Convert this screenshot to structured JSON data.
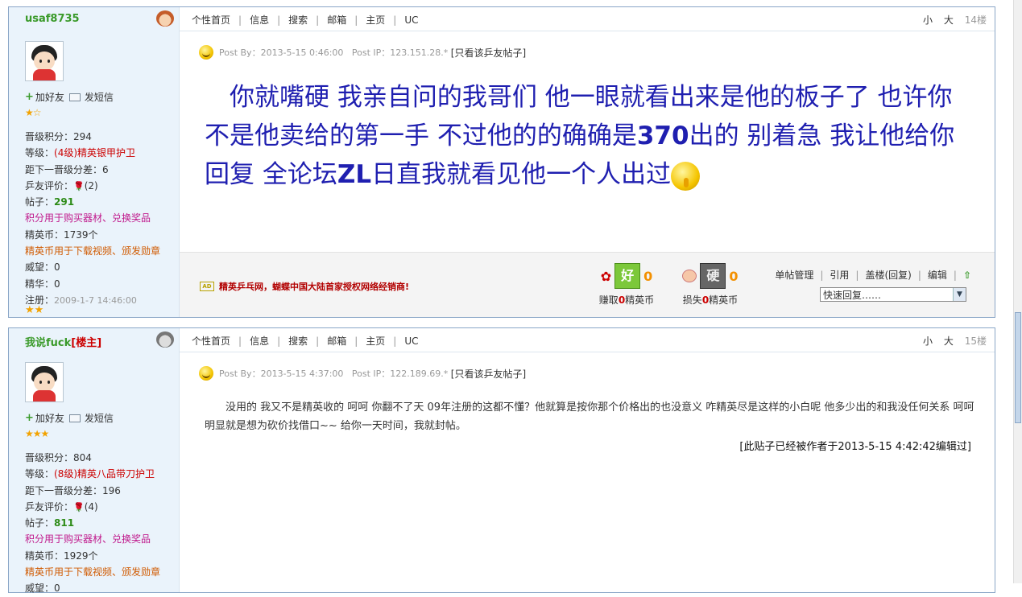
{
  "nav": [
    "个性首页",
    "信息",
    "搜索",
    "邮箱",
    "主页",
    "UC"
  ],
  "font_small": "小",
  "font_large": "大",
  "posts": [
    {
      "user": "usaf8735",
      "tag": "",
      "add_friend": "加好友",
      "send_msg": "发短信",
      "stars": "★☆",
      "info": [
        {
          "label": "晋级积分：",
          "value": "294"
        },
        {
          "label": "等级：",
          "value": "(4级)精英银甲护卫"
        },
        {
          "label": "距下一晋级分差：",
          "value": "6"
        },
        {
          "label": "乒友评价：",
          "value": "(2)"
        },
        {
          "label": "帖子：",
          "value": "291"
        },
        {
          "label": "",
          "value": "积分用于购买器材、兑换奖品"
        },
        {
          "label": "精英币：",
          "value": "1739个"
        },
        {
          "label": "",
          "value": "精英币用于下载视频、颁发勋章"
        },
        {
          "label": "威望：",
          "value": "0"
        },
        {
          "label": "精华：",
          "value": "0"
        },
        {
          "label": "注册：",
          "value": "2009-1-7 14:46:00"
        }
      ],
      "bottom_stars": "★★",
      "floor": "14楼",
      "post_by": "Post By：2013-5-15 0:46:00",
      "post_ip": "Post IP：123.151.28.*",
      "only_view": "[只看该乒友帖子]",
      "content_parts": [
        "　你就嘴硬  我亲自问的我哥们  他一眼就看出来是他的板子了  也许你不是他卖给的第一手  不过他的的确确是",
        "370",
        "出的  别着急  我让他给你回复  全论坛",
        "ZL",
        "日直我就看见他一个人出过"
      ],
      "ad_text": "精英乒乓网，蝴蝶中国大陆首家授权网络经销商!",
      "good_label": "好",
      "hard_label": "硬",
      "good_count": "0",
      "bad_count": "0",
      "earn_text": "赚取",
      "earn_num": "0",
      "earn_unit": "精英币",
      "lose_text": "损失",
      "lose_num": "0",
      "lose_unit": "精英币",
      "manage": [
        "单帖管理",
        "引用",
        "盖楼(回复)",
        "编辑"
      ],
      "quick_reply": "快速回复……"
    },
    {
      "user": "我说fuck",
      "tag": "[楼主]",
      "add_friend": "加好友",
      "send_msg": "发短信",
      "stars": "★★★",
      "info": [
        {
          "label": "晋级积分：",
          "value": "804"
        },
        {
          "label": "等级：",
          "value": "(8级)精英八品带刀护卫"
        },
        {
          "label": "距下一晋级分差：",
          "value": "196"
        },
        {
          "label": "乒友评价：",
          "value": "(4)"
        },
        {
          "label": "帖子：",
          "value": "811"
        },
        {
          "label": "",
          "value": "积分用于购买器材、兑换奖品"
        },
        {
          "label": "精英币：",
          "value": "1929个"
        },
        {
          "label": "",
          "value": "精英币用于下载视频、颁发勋章"
        },
        {
          "label": "威望：",
          "value": "0"
        }
      ],
      "floor": "15楼",
      "post_by": "Post By：2013-5-15 4:37:00",
      "post_ip": "Post IP：122.189.69.*",
      "only_view": "[只看该乒友帖子]",
      "content": "没用的  我又不是精英收的  呵呵  你翻不了天    09年注册的这都不懂？他就算是按你那个价格出的也没意义    咋精英尽是这样的小白呢   他多少出的和我没任何关系  呵呵  明显就是想为砍价找借口~~  给你一天时间，我就封帖。",
      "edited": "[此贴子已经被作者于2013-5-15 4:42:42编辑过]"
    }
  ]
}
